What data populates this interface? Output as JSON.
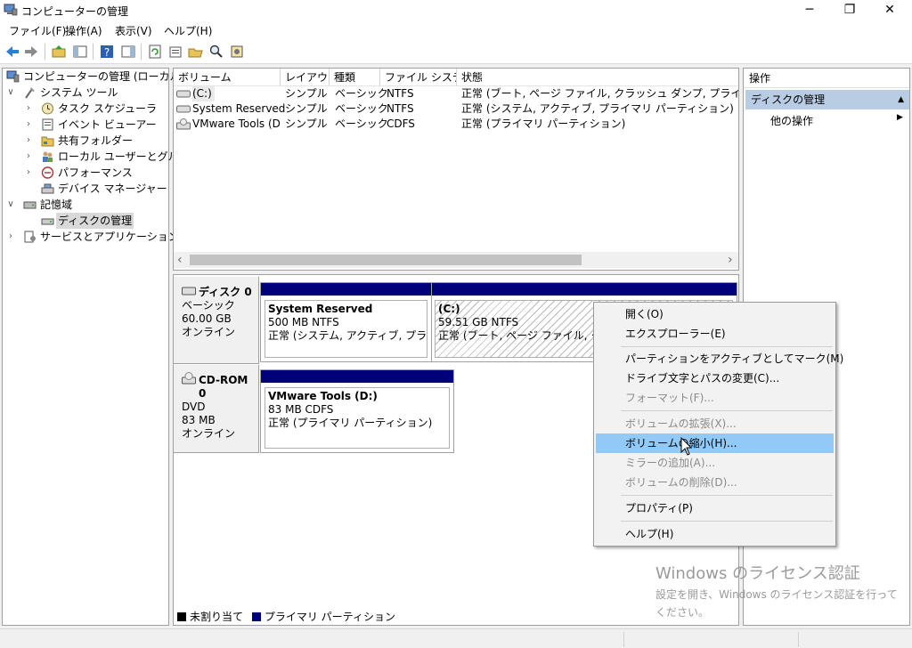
{
  "window": {
    "title": "コンピューターの管理",
    "controls": {
      "minimize": "─",
      "maximize": "❐",
      "close": "✕"
    }
  },
  "menu": [
    "ファイル(F)",
    "操作(A)",
    "表示(V)",
    "ヘルプ(H)"
  ],
  "toolbar": [
    "back-icon",
    "forward-icon",
    "up-folder-icon",
    "show-hide-tree-icon",
    "help-icon",
    "show-hide-action-icon",
    "refresh-icon",
    "properties-icon",
    "open-icon",
    "search-icon",
    "settings-icon"
  ],
  "tree": {
    "root": "コンピューターの管理 (ローカル)",
    "system_tools": "システム ツール",
    "task_scheduler": "タスク スケジューラ",
    "event_viewer": "イベント ビューアー",
    "shared_folders": "共有フォルダー",
    "local_users": "ローカル ユーザーとグループ",
    "performance": "パフォーマンス",
    "device_manager": "デバイス マネージャー",
    "storage": "記憶域",
    "disk_management": "ディスクの管理",
    "services_apps": "サービスとアプリケーション"
  },
  "volumes": {
    "columns": [
      "ボリューム",
      "レイアウト",
      "種類",
      "ファイル システム",
      "状態"
    ],
    "rows": [
      {
        "name": "(C:)",
        "layout": "シンプル",
        "type": "ベーシック",
        "fs": "NTFS",
        "status": "正常 (ブート, ページ ファイル, クラッシュ ダンプ, プライマリ パーティション)"
      },
      {
        "name": "System Reserved",
        "layout": "シンプル",
        "type": "ベーシック",
        "fs": "NTFS",
        "status": "正常 (システム, アクティブ, プライマリ パーティション)"
      },
      {
        "name": "VMware Tools (D:)",
        "layout": "シンプル",
        "type": "ベーシック",
        "fs": "CDFS",
        "status": "正常 (プライマリ パーティション)"
      }
    ],
    "scroll_left": "‹",
    "scroll_right": "›"
  },
  "disks": [
    {
      "name": "ディスク 0",
      "type": "ベーシック",
      "size": "60.00 GB",
      "state": "オンライン",
      "partitions": [
        {
          "name": "System Reserved",
          "size": "500 MB NTFS",
          "status": "正常 (システム, アクティブ, プライマリ パーティション)"
        },
        {
          "name": "(C:)",
          "size": "59.51 GB NTFS",
          "status": "正常 (ブート, ページ ファイル, クラッシュ ダンプ, プライマリ パーティション)"
        }
      ]
    },
    {
      "name": "CD-ROM 0",
      "type": "DVD",
      "size": "83 MB",
      "state": "オンライン",
      "partitions": [
        {
          "name": "VMware Tools  (D:)",
          "size": "83 MB CDFS",
          "status": "正常 (プライマリ パーティション)"
        }
      ]
    }
  ],
  "legend": {
    "unallocated": "未割り当て",
    "primary": "プライマリ パーティション",
    "unallocated_color": "#000000",
    "primary_color": "#00007b"
  },
  "actions": {
    "header": "操作",
    "section": "ディスクの管理",
    "more": "他の操作"
  },
  "context_menu": {
    "open": "開く(O)",
    "explore": "エクスプローラー(E)",
    "mark_active": "パーティションをアクティブとしてマーク(M)",
    "change_letter": "ドライブ文字とパスの変更(C)...",
    "format": "フォーマット(F)...",
    "extend": "ボリュームの拡張(X)...",
    "shrink": "ボリュームの縮小(H)...",
    "add_mirror": "ミラーの追加(A)...",
    "delete": "ボリュームの削除(D)...",
    "properties": "プロパティ(P)",
    "help": "ヘルプ(H)"
  },
  "watermark": {
    "title": "Windows のライセンス認証",
    "text": "設定を開き、Windows のライセンス認証を行ってください。"
  },
  "colors": {
    "accent": "#00007b",
    "selection": "#91c9f7",
    "action_header": "#b8cce4"
  }
}
